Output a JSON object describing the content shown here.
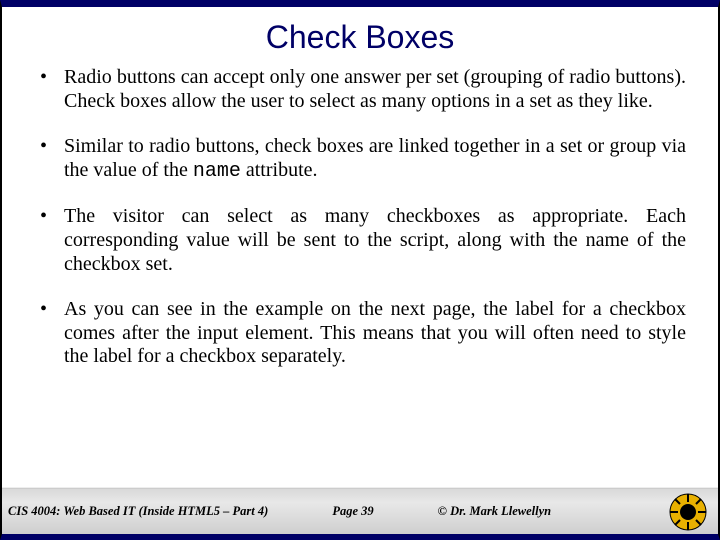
{
  "title": "Check Boxes",
  "bullets": {
    "b1": "Radio buttons can accept only one answer per set (grouping of radio buttons).  Check boxes allow the user to select as many options in a set as they like.",
    "b2_pre": "Similar to radio buttons, check boxes are linked together in a set or group via the value of the ",
    "b2_code": "name",
    "b2_post": " attribute.",
    "b3": "The visitor can select as many checkboxes as appropriate.  Each corresponding value will be sent to the script, along with the name of the checkbox set.",
    "b4": "As you can see in the example on the next page, the label for a checkbox comes after the input element.  This means that you will often need to style the label for a checkbox separately."
  },
  "footer": {
    "course": "CIS 4004: Web Based IT (Inside HTML5 – Part 4)",
    "page": "Page 39",
    "author": "© Dr. Mark Llewellyn"
  }
}
